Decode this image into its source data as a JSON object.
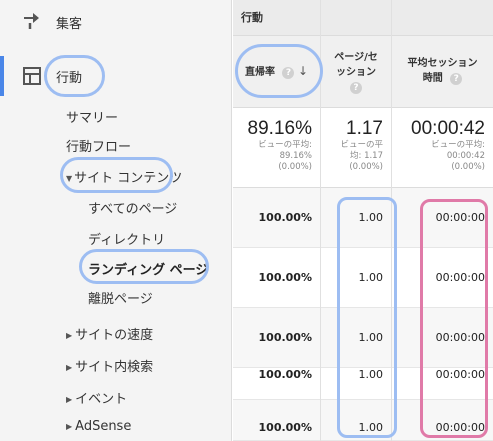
{
  "sidebar": {
    "audience": {
      "label": "集客",
      "icon": "acquisition-arrows-icon"
    },
    "behavior": {
      "label": "行動",
      "icon": "behavior-grid-icon"
    },
    "items": [
      {
        "label": "サマリー"
      },
      {
        "label": "行動フロー"
      },
      {
        "label": "サイト コンテンツ"
      },
      {
        "label": "すべてのページ"
      },
      {
        "label": "ディレクトリ"
      },
      {
        "label": "ランディング ページ"
      },
      {
        "label": "離脱ページ"
      },
      {
        "label": "サイトの速度"
      },
      {
        "label": "サイト内検索"
      },
      {
        "label": "イベント"
      },
      {
        "label": "AdSense"
      }
    ]
  },
  "table": {
    "group_header": "行動",
    "columns": [
      {
        "label": "直帰率",
        "help": "?",
        "sort": "↓"
      },
      {
        "label_line1": "ページ/セ",
        "label_line2": "ッション",
        "help": "?"
      },
      {
        "label_line1": "平均セッション",
        "label_line2": "時間",
        "help": "?"
      }
    ],
    "summary": [
      {
        "value": "89.16%",
        "avg_line1": "ビューの平均:",
        "avg_line2": "89.16%",
        "avg_line3": "(0.00%)"
      },
      {
        "value": "1.17",
        "avg_line1": "ビューの平",
        "avg_line2": "均: 1.17",
        "avg_line3": "(0.00%)"
      },
      {
        "value": "00:00:42",
        "avg_line1": "ビューの平均:",
        "avg_line2": "00:00:42",
        "avg_line3": "(0.00%)"
      }
    ],
    "rows": [
      [
        "100.00%",
        "1.00",
        "00:00:00"
      ],
      [
        "100.00%",
        "1.00",
        "00:00:00"
      ],
      [
        "100.00%",
        "1.00",
        "00:00:00"
      ],
      [
        "100.00%",
        "1.00",
        "00:00:00"
      ],
      [
        "100.00%",
        "1.00",
        "00:00:00"
      ]
    ]
  },
  "colors": {
    "highlight_blue": "#9dbdf2",
    "highlight_pink": "#e07aa8",
    "active_accent": "#4a86e8"
  }
}
